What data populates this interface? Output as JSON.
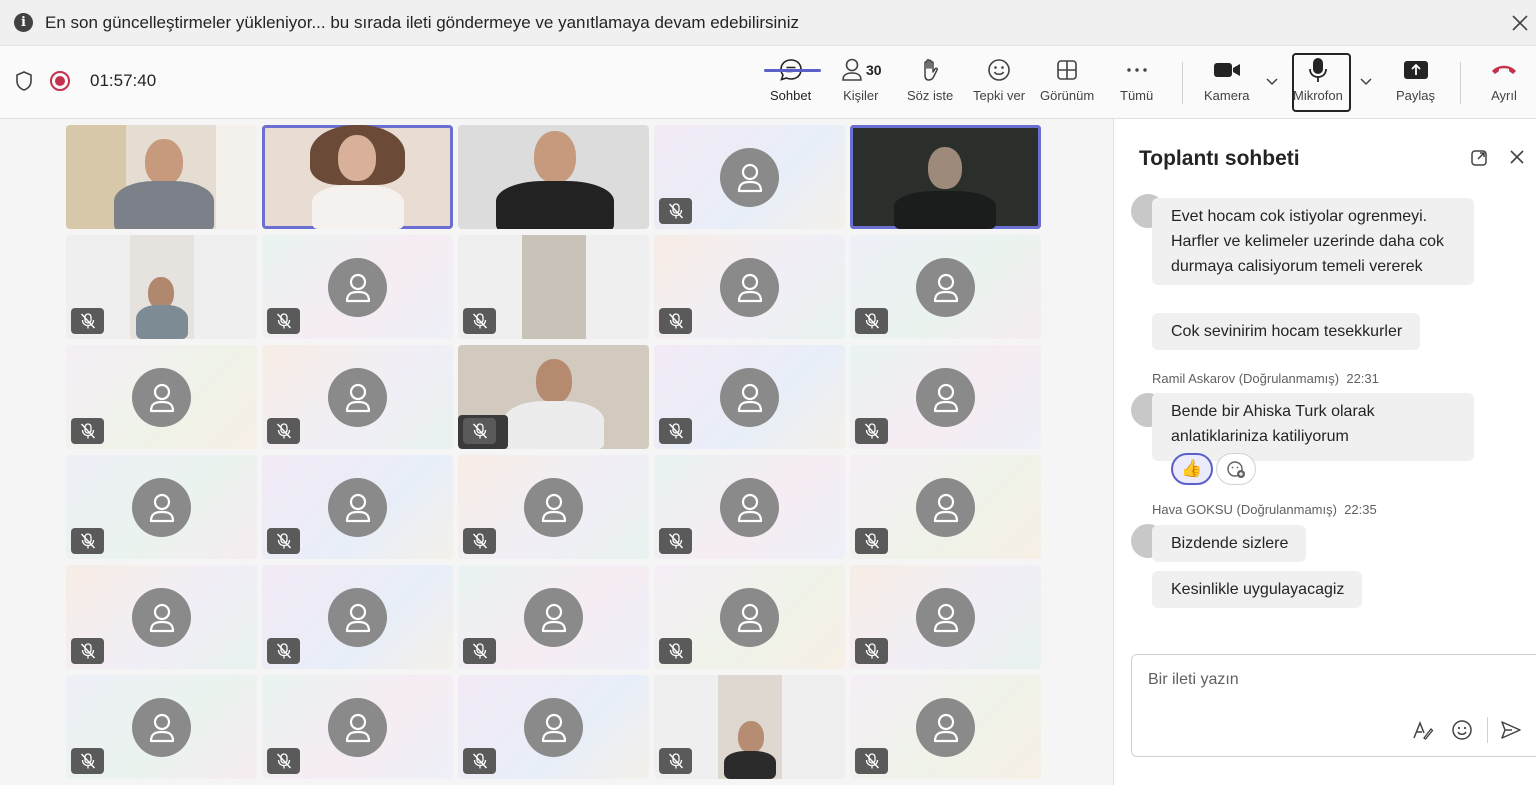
{
  "banner": {
    "message": "En son güncelleştirmeler yükleniyor... bu sırada ileti göndermeye ve yanıtlamaya devam edebilirsiniz"
  },
  "toolbar": {
    "timer": "01:57:40",
    "chat_label": "Sohbet",
    "people_label": "Kişiler",
    "people_count": "30",
    "raise_hand_label": "Söz iste",
    "react_label": "Tepki ver",
    "view_label": "Görünüm",
    "more_label": "Tümü",
    "camera_label": "Kamera",
    "mic_label": "Mikrofon",
    "share_label": "Paylaş",
    "leave_label": "Ayrıl"
  },
  "chat": {
    "title": "Toplantı sohbeti",
    "messages": [
      {
        "text": "Evet hocam cok istiyolar ogrenmeyi. Harfler ve kelimeler uzerinde daha cok durmaya calisiyorum temeli vererek"
      },
      {
        "text": "Cok sevinirim hocam tesekkurler"
      },
      {
        "sender": "Ramil Askarov (Doğrulanmamış)",
        "time": "22:31",
        "text": "Bende bir Ahiska Turk olarak anlatiklariniza katiliyorum"
      },
      {
        "sender": "Hava GOKSU (Doğrulanmamış)",
        "time": "22:35",
        "text": "Bizdende sizlere"
      },
      {
        "text": "Kesinlikle uygulayacagiz"
      }
    ],
    "reaction_emoji": "👍",
    "compose_placeholder": "Bir ileti yazın"
  },
  "colors": {
    "accent": "#5b5fc7",
    "record": "#c4314b",
    "leave": "#c4314b"
  }
}
